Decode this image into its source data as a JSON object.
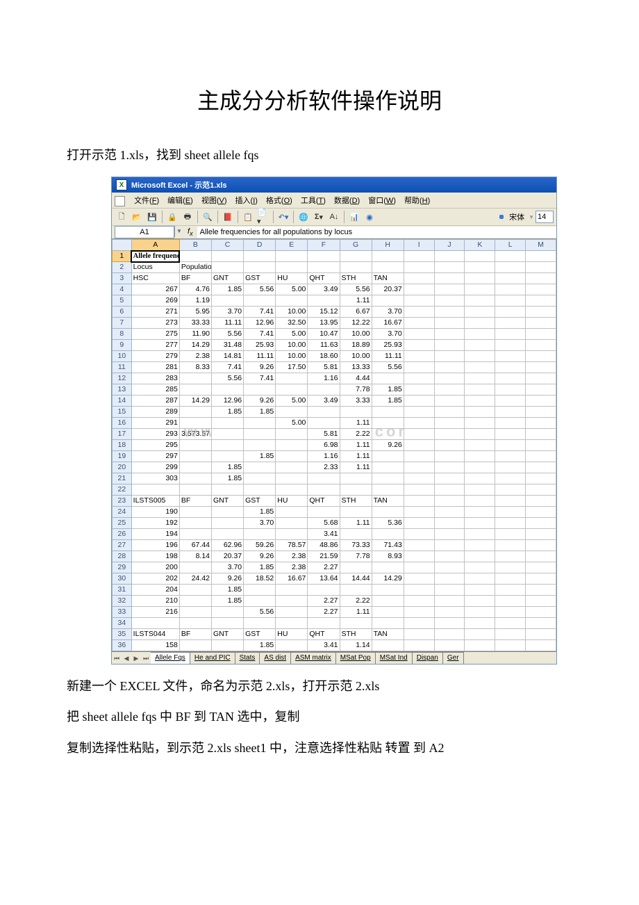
{
  "title": "主成分分析软件操作说明",
  "para1": "打开示范 1.xls，找到 sheet allele fqs",
  "para2": "新建一个 EXCEL 文件，命名为示范 2.xls，打开示范 2.xls",
  "para3": "把 sheet allele fqs 中 BF 到 TAN 选中，复制",
  "para4": "复制选择性粘贴，到示范 2.xls sheet1 中，注意选择性粘贴 转置 到 A2",
  "excel": {
    "app_title": "Microsoft Excel - 示范1.xls",
    "menus": [
      "文件(F)",
      "编辑(E)",
      "视图(V)",
      "插入(I)",
      "格式(O)",
      "工具(T)",
      "数据(D)",
      "窗口(W)",
      "帮助(H)"
    ],
    "font_name": "宋体",
    "font_size": "14",
    "name_box": "A1",
    "formula_text": "Allele frequencies for all populations by locus",
    "col_headers": [
      "A",
      "B",
      "C",
      "D",
      "E",
      "F",
      "G",
      "H",
      "I",
      "J",
      "K",
      "L",
      "M"
    ],
    "row1_text": "Allele frequencies for all populations by locus",
    "sheet_tabs": [
      "Allele Fqs",
      "He and PIC",
      "Stats",
      "AS dist",
      "ASM matrix",
      "MSat Pop",
      "MSat Ind",
      "Dispan",
      "Ger"
    ],
    "active_tab_index": 0,
    "rows": [
      {
        "n": 2,
        "cells": [
          "Locus",
          "Populations....",
          "",
          "",
          "",
          "",
          "",
          "",
          "",
          "",
          "",
          "",
          ""
        ]
      },
      {
        "n": 3,
        "cells": [
          "HSC",
          "BF",
          "GNT",
          "GST",
          "HU",
          "QHT",
          "STH",
          "TAN",
          "",
          "",
          "",
          "",
          ""
        ]
      },
      {
        "n": 4,
        "cells": [
          "267",
          "4.76",
          "1.85",
          "5.56",
          "5.00",
          "3.49",
          "5.56",
          "20.37",
          "",
          "",
          "",
          "",
          ""
        ]
      },
      {
        "n": 5,
        "cells": [
          "269",
          "1.19",
          "",
          "",
          "",
          "",
          "1.11",
          "",
          "",
          "",
          "",
          "",
          ""
        ]
      },
      {
        "n": 6,
        "cells": [
          "271",
          "5.95",
          "3.70",
          "7.41",
          "10.00",
          "15.12",
          "6.67",
          "3.70",
          "",
          "",
          "",
          "",
          ""
        ]
      },
      {
        "n": 7,
        "cells": [
          "273",
          "33.33",
          "11.11",
          "12.96",
          "32.50",
          "13.95",
          "12.22",
          "16.67",
          "",
          "",
          "",
          "",
          ""
        ]
      },
      {
        "n": 8,
        "cells": [
          "275",
          "11.90",
          "5.56",
          "7.41",
          "5.00",
          "10.47",
          "10.00",
          "3.70",
          "",
          "",
          "",
          "",
          ""
        ]
      },
      {
        "n": 9,
        "cells": [
          "277",
          "14.29",
          "31.48",
          "25.93",
          "10.00",
          "11.63",
          "18.89",
          "25.93",
          "",
          "",
          "",
          "",
          ""
        ]
      },
      {
        "n": 10,
        "cells": [
          "279",
          "2.38",
          "14.81",
          "11.11",
          "10.00",
          "18.60",
          "10.00",
          "11.11",
          "",
          "",
          "",
          "",
          ""
        ]
      },
      {
        "n": 11,
        "cells": [
          "281",
          "8.33",
          "7.41",
          "9.26",
          "17.50",
          "5.81",
          "13.33",
          "5.56",
          "",
          "",
          "",
          "",
          ""
        ]
      },
      {
        "n": 12,
        "cells": [
          "283",
          "",
          "5.56",
          "7.41",
          "",
          "1.16",
          "4.44",
          "",
          "",
          "",
          "",
          "",
          ""
        ]
      },
      {
        "n": 13,
        "cells": [
          "285",
          "",
          "",
          "",
          "",
          "",
          "7.78",
          "1.85",
          "",
          "",
          "",
          "",
          ""
        ]
      },
      {
        "n": 14,
        "cells": [
          "287",
          "14.29",
          "12.96",
          "9.26",
          "5.00",
          "3.49",
          "3.33",
          "1.85",
          "",
          "",
          "",
          "",
          ""
        ]
      },
      {
        "n": 15,
        "cells": [
          "289",
          "",
          "1.85",
          "1.85",
          "",
          "",
          "",
          "",
          "",
          "",
          "",
          "",
          ""
        ]
      },
      {
        "n": 16,
        "cells": [
          "291",
          "",
          "",
          "",
          "5.00",
          "",
          "1.11",
          "",
          "",
          "",
          "",
          "",
          ""
        ]
      },
      {
        "n": 17,
        "cells": [
          "293",
          "3.57",
          "",
          "",
          "",
          "5.81",
          "2.22",
          "",
          "",
          "",
          "",
          "",
          ""
        ]
      },
      {
        "n": 18,
        "cells": [
          "295",
          "",
          "",
          "",
          "",
          "6.98",
          "1.11",
          "9.26",
          "",
          "",
          "",
          "",
          ""
        ]
      },
      {
        "n": 19,
        "cells": [
          "297",
          "",
          "",
          "1.85",
          "",
          "1.16",
          "1.11",
          "",
          "",
          "",
          "",
          "",
          ""
        ]
      },
      {
        "n": 20,
        "cells": [
          "299",
          "",
          "1.85",
          "",
          "",
          "2.33",
          "1.11",
          "",
          "",
          "",
          "",
          "",
          ""
        ]
      },
      {
        "n": 21,
        "cells": [
          "303",
          "",
          "1.85",
          "",
          "",
          "",
          "",
          "",
          "",
          "",
          "",
          "",
          ""
        ]
      },
      {
        "n": 22,
        "cells": [
          "",
          "",
          "",
          "",
          "",
          "",
          "",
          "",
          "",
          "",
          "",
          "",
          ""
        ]
      },
      {
        "n": 23,
        "cells": [
          "ILSTS005",
          "BF",
          "GNT",
          "GST",
          "HU",
          "QHT",
          "STH",
          "TAN",
          "",
          "",
          "",
          "",
          ""
        ]
      },
      {
        "n": 24,
        "cells": [
          "190",
          "",
          "",
          "1.85",
          "",
          "",
          "",
          "",
          "",
          "",
          "",
          "",
          ""
        ]
      },
      {
        "n": 25,
        "cells": [
          "192",
          "",
          "",
          "3.70",
          "",
          "5.68",
          "1.11",
          "5.36",
          "",
          "",
          "",
          "",
          ""
        ]
      },
      {
        "n": 26,
        "cells": [
          "194",
          "",
          "",
          "",
          "",
          "3.41",
          "",
          "",
          "",
          "",
          "",
          "",
          ""
        ]
      },
      {
        "n": 27,
        "cells": [
          "196",
          "67.44",
          "62.96",
          "59.26",
          "78.57",
          "48.86",
          "73.33",
          "71.43",
          "",
          "",
          "",
          "",
          ""
        ]
      },
      {
        "n": 28,
        "cells": [
          "198",
          "8.14",
          "20.37",
          "9.26",
          "2.38",
          "21.59",
          "7.78",
          "8.93",
          "",
          "",
          "",
          "",
          ""
        ]
      },
      {
        "n": 29,
        "cells": [
          "200",
          "",
          "3.70",
          "1.85",
          "2.38",
          "2.27",
          "",
          "",
          "",
          "",
          "",
          "",
          ""
        ]
      },
      {
        "n": 30,
        "cells": [
          "202",
          "24.42",
          "9.26",
          "18.52",
          "16.67",
          "13.64",
          "14.44",
          "14.29",
          "",
          "",
          "",
          "",
          ""
        ]
      },
      {
        "n": 31,
        "cells": [
          "204",
          "",
          "1.85",
          "",
          "",
          "",
          "",
          "",
          "",
          "",
          "",
          "",
          ""
        ]
      },
      {
        "n": 32,
        "cells": [
          "210",
          "",
          "1.85",
          "",
          "",
          "2.27",
          "2.22",
          "",
          "",
          "",
          "",
          "",
          ""
        ]
      },
      {
        "n": 33,
        "cells": [
          "216",
          "",
          "",
          "5.56",
          "",
          "2.27",
          "1.11",
          "",
          "",
          "",
          "",
          "",
          ""
        ]
      },
      {
        "n": 34,
        "cells": [
          "",
          "",
          "",
          "",
          "",
          "",
          "",
          "",
          "",
          "",
          "",
          "",
          ""
        ]
      },
      {
        "n": 35,
        "cells": [
          "ILSTS044",
          "BF",
          "GNT",
          "GST",
          "HU",
          "QHT",
          "STH",
          "TAN",
          "",
          "",
          "",
          "",
          ""
        ]
      },
      {
        "n": 36,
        "cells": [
          "158",
          "",
          "",
          "1.85",
          "",
          "3.41",
          "1.14",
          "",
          "",
          "",
          "",
          "",
          ""
        ]
      }
    ],
    "watermark_left": "WWW",
    "watermark_right": ".com"
  }
}
